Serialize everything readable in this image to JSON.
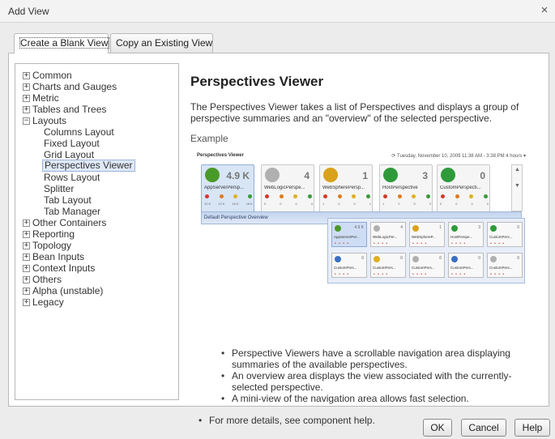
{
  "window": {
    "title": "Add View",
    "close_glyph": "×"
  },
  "tabs": [
    {
      "label": "Create a Blank View",
      "active": true
    },
    {
      "label": "Copy an Existing View",
      "active": false
    }
  ],
  "tree": {
    "items": [
      {
        "label": "Common",
        "expander": "+"
      },
      {
        "label": "Charts and Gauges",
        "expander": "+"
      },
      {
        "label": "Metric",
        "expander": "+"
      },
      {
        "label": "Tables and Trees",
        "expander": "+"
      },
      {
        "label": "Layouts",
        "expander": "−"
      },
      {
        "label": "Columns Layout",
        "child": true
      },
      {
        "label": "Fixed Layout",
        "child": true
      },
      {
        "label": "Grid Layout",
        "child": true
      },
      {
        "label": "Perspectives Viewer",
        "child": true,
        "selected": true
      },
      {
        "label": "Rows Layout",
        "child": true
      },
      {
        "label": "Splitter",
        "child": true
      },
      {
        "label": "Tab Layout",
        "child": true
      },
      {
        "label": "Tab Manager",
        "child": true
      },
      {
        "label": "Other Containers",
        "expander": "+"
      },
      {
        "label": "Reporting",
        "expander": "+"
      },
      {
        "label": "Topology",
        "expander": "+"
      },
      {
        "label": "Bean Inputs",
        "expander": "+"
      },
      {
        "label": "Context Inputs",
        "expander": "+"
      },
      {
        "label": "Others",
        "expander": "+"
      },
      {
        "label": "Alpha (unstable)",
        "expander": "+"
      },
      {
        "label": "Legacy",
        "expander": "+"
      }
    ]
  },
  "content": {
    "title": "Perspectives Viewer",
    "description": "The Perspectives Viewer takes a list of Perspectives and displays a group of perspective summaries and an \"overview\" of the selected perspective.",
    "example_label": "Example",
    "preview": {
      "title": "Perspectives Viewer",
      "date": "⟳ Tuesday, November 10, 2009 11:38 AM - 3:38 PM 4 hours ▾",
      "cards": [
        {
          "name": "AppServerPersp...",
          "count": "4.9 K",
          "icon": "appserver-icon",
          "color": "#4a9a2a",
          "selected": true,
          "nums": [
            "12 K",
            "12 K",
            "16 K",
            "16 K"
          ]
        },
        {
          "name": "WebLogicPerspe...",
          "count": "4",
          "icon": "weblogic-icon",
          "color": "#b0b0b0",
          "nums": [
            "0",
            "0",
            "0",
            "4"
          ]
        },
        {
          "name": "WebSpherePersp...",
          "count": "1",
          "icon": "websphere-icon",
          "color": "#d9a21c",
          "nums": [
            "1",
            "0",
            "0",
            "1"
          ]
        },
        {
          "name": "HostPerspective",
          "count": "3",
          "icon": "check-icon",
          "color": "#2e9a3a",
          "nums": [
            "1",
            "0",
            "0",
            "3"
          ]
        },
        {
          "name": "CustomPerspecti...",
          "count": "0",
          "icon": "check-icon",
          "color": "#2e9a3a",
          "nums": [
            "0",
            "0",
            "0",
            "0"
          ]
        }
      ],
      "overview_label": "Default Perspective Overview",
      "mini_cards": [
        {
          "label": "AppServerPer...",
          "count": "4.9 K",
          "color": "#4a9a2a",
          "selected": true
        },
        {
          "label": "WebLogicPer...",
          "count": "4",
          "color": "#b0b0b0"
        },
        {
          "label": "WebSphereP...",
          "count": "1",
          "color": "#d9a21c"
        },
        {
          "label": "HostPerspe...",
          "count": "3",
          "color": "#2e9a3a"
        },
        {
          "label": "CustomPers...",
          "count": "0",
          "color": "#2e9a3a"
        },
        {
          "label": "CustomPers...",
          "count": "0",
          "color": "#3a6fc4"
        },
        {
          "label": "CustomPers...",
          "count": "0",
          "color": "#e0b020"
        },
        {
          "label": "CustomPers...",
          "count": "0",
          "color": "#b0b0b0"
        },
        {
          "label": "CustomPers...",
          "count": "0",
          "color": "#3a6fc4"
        },
        {
          "label": "CustomPers...",
          "count": "0",
          "color": "#b0b0b0"
        }
      ]
    },
    "bullets": [
      "Perspective Viewers have a scrollable navigation area displaying summaries of the available perspectives.",
      "An overview area displays the view associated with the currently-selected perspective.",
      "A mini-view of the navigation area allows fast selection."
    ],
    "more_details": "For more details, see component help."
  },
  "buttons": {
    "ok": "OK",
    "cancel": "Cancel",
    "help": "Help"
  }
}
